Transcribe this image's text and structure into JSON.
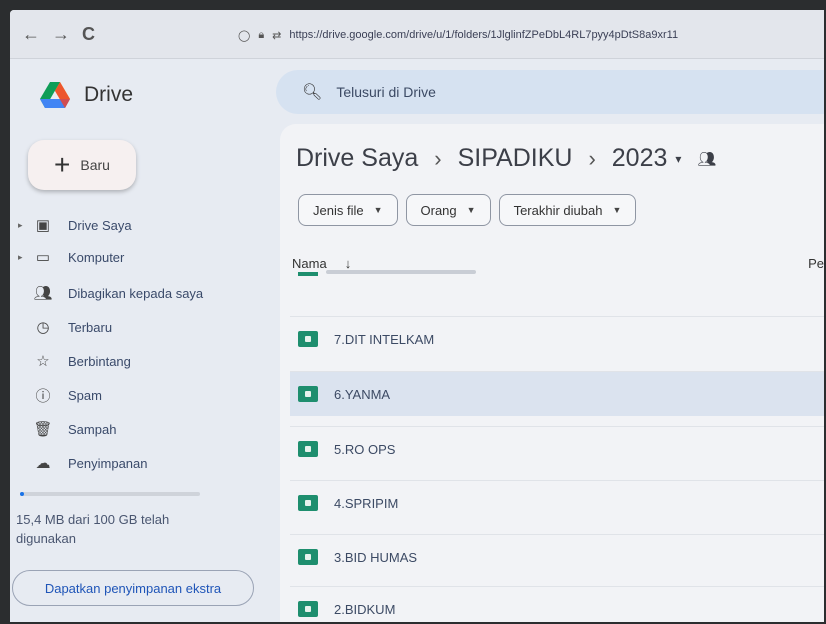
{
  "browser": {
    "back": "←",
    "forward": "→",
    "reload": "C",
    "url": "https://drive.google.com/drive/u/1/folders/1JlglinfZPeDbL4RL7pyy4pDtS8a9xr11"
  },
  "sidebar": {
    "app_name": "Drive",
    "new_label": "Baru",
    "items": [
      {
        "label": "Drive Saya",
        "icon": "drive-icon",
        "expandable": true
      },
      {
        "label": "Komputer",
        "icon": "computer-icon",
        "expandable": true
      },
      {
        "label": "Dibagikan kepada saya",
        "icon": "shared-icon",
        "expandable": false
      },
      {
        "label": "Terbaru",
        "icon": "clock-icon",
        "expandable": false
      },
      {
        "label": "Berbintang",
        "icon": "star-icon",
        "expandable": false
      },
      {
        "label": "Spam",
        "icon": "spam-icon",
        "expandable": false
      },
      {
        "label": "Sampah",
        "icon": "trash-icon",
        "expandable": false
      },
      {
        "label": "Penyimpanan",
        "icon": "cloud-icon",
        "expandable": false
      }
    ],
    "storage_text": "15,4 MB dari 100 GB telah digunakan",
    "storage_used_fraction": 0.001,
    "extra_storage_label": "Dapatkan penyimpanan ekstra"
  },
  "search": {
    "placeholder": "Telusuri di Drive"
  },
  "breadcrumb": {
    "root": "Drive Saya",
    "parent": "SIPADIKU",
    "current": "2023",
    "sep": "›"
  },
  "filters": [
    "Jenis file",
    "Orang",
    "Terakhir diubah"
  ],
  "columns": {
    "name": "Nama",
    "sort_arrow": "↓",
    "owner_partial": "Pe"
  },
  "folders": [
    {
      "name": "7.DIT INTELKAM",
      "selected": false
    },
    {
      "name": "6.YANMA",
      "selected": true
    },
    {
      "name": "5.RO OPS",
      "selected": false
    },
    {
      "name": "4.SPRIPIM",
      "selected": false
    },
    {
      "name": "3.BID HUMAS",
      "selected": false
    },
    {
      "name": "2.BIDKUM",
      "selected": false
    }
  ],
  "colors": {
    "accent": "#1a73e8",
    "folder": "#1e8e6e",
    "selected_row": "#dbe3ef"
  }
}
